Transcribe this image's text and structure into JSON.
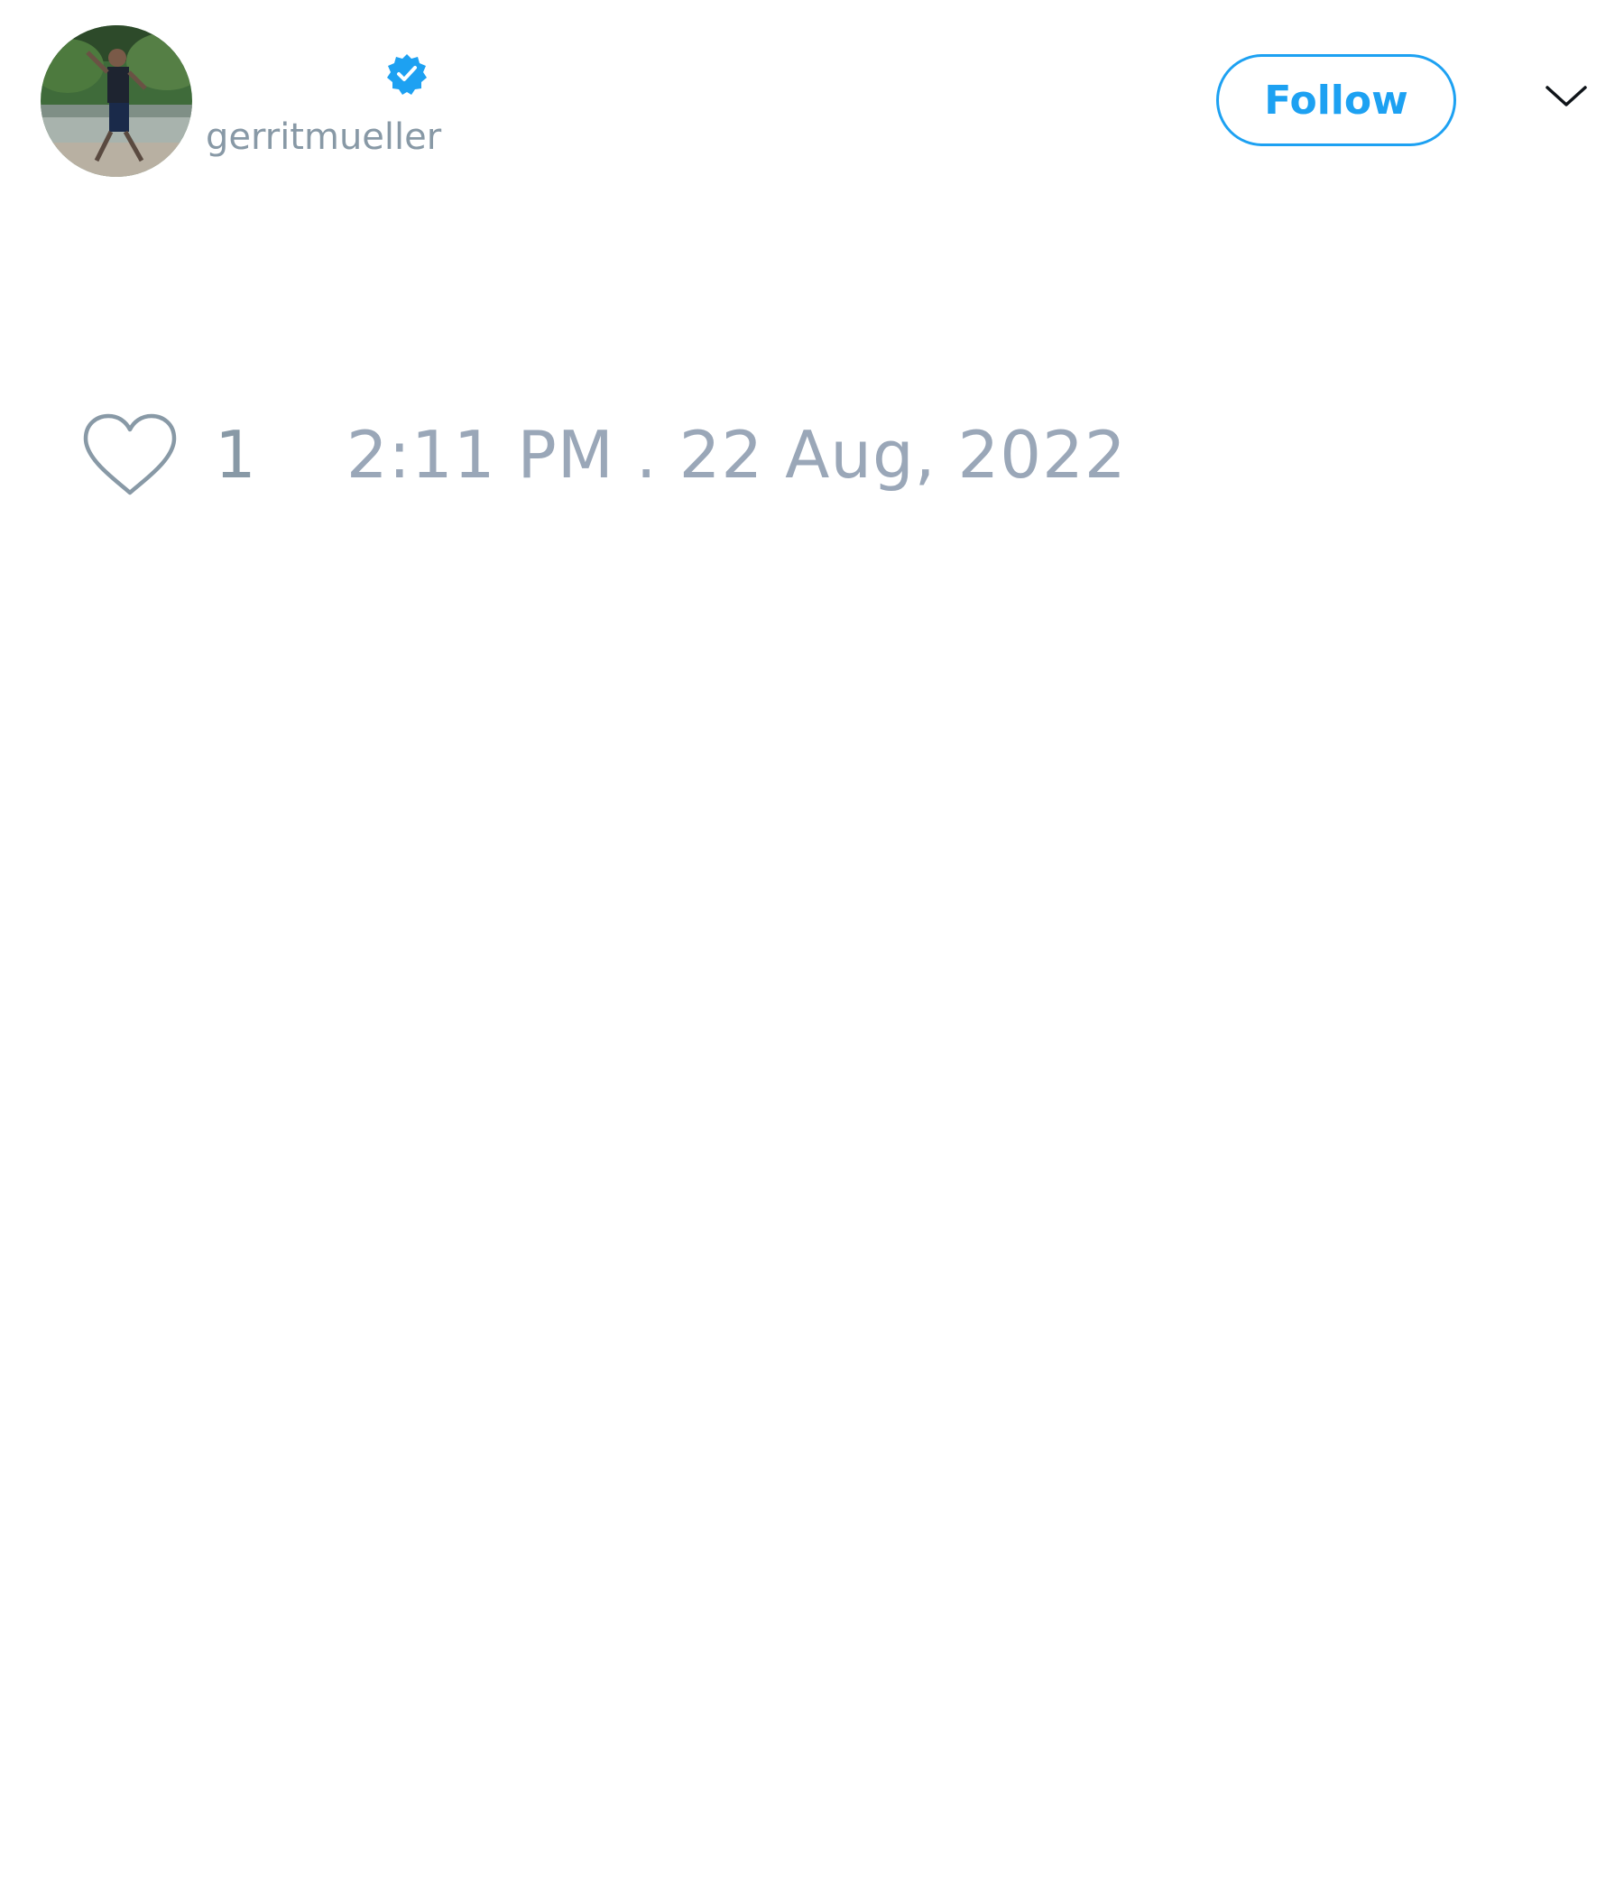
{
  "user": {
    "display_name": "",
    "handle": "gerritmueller",
    "verified": true,
    "avatar_icon": "avatar-photo"
  },
  "actions": {
    "follow_label": "Follow",
    "menu_icon": "chevron-down-icon"
  },
  "tweet": {
    "like_icon": "heart-icon",
    "like_count": "1",
    "timestamp": "2:11 PM . 22 Aug, 2022"
  },
  "colors": {
    "accent": "#1da1f2",
    "muted_text": "#8899a6",
    "icon_outline": "#8899a6"
  }
}
